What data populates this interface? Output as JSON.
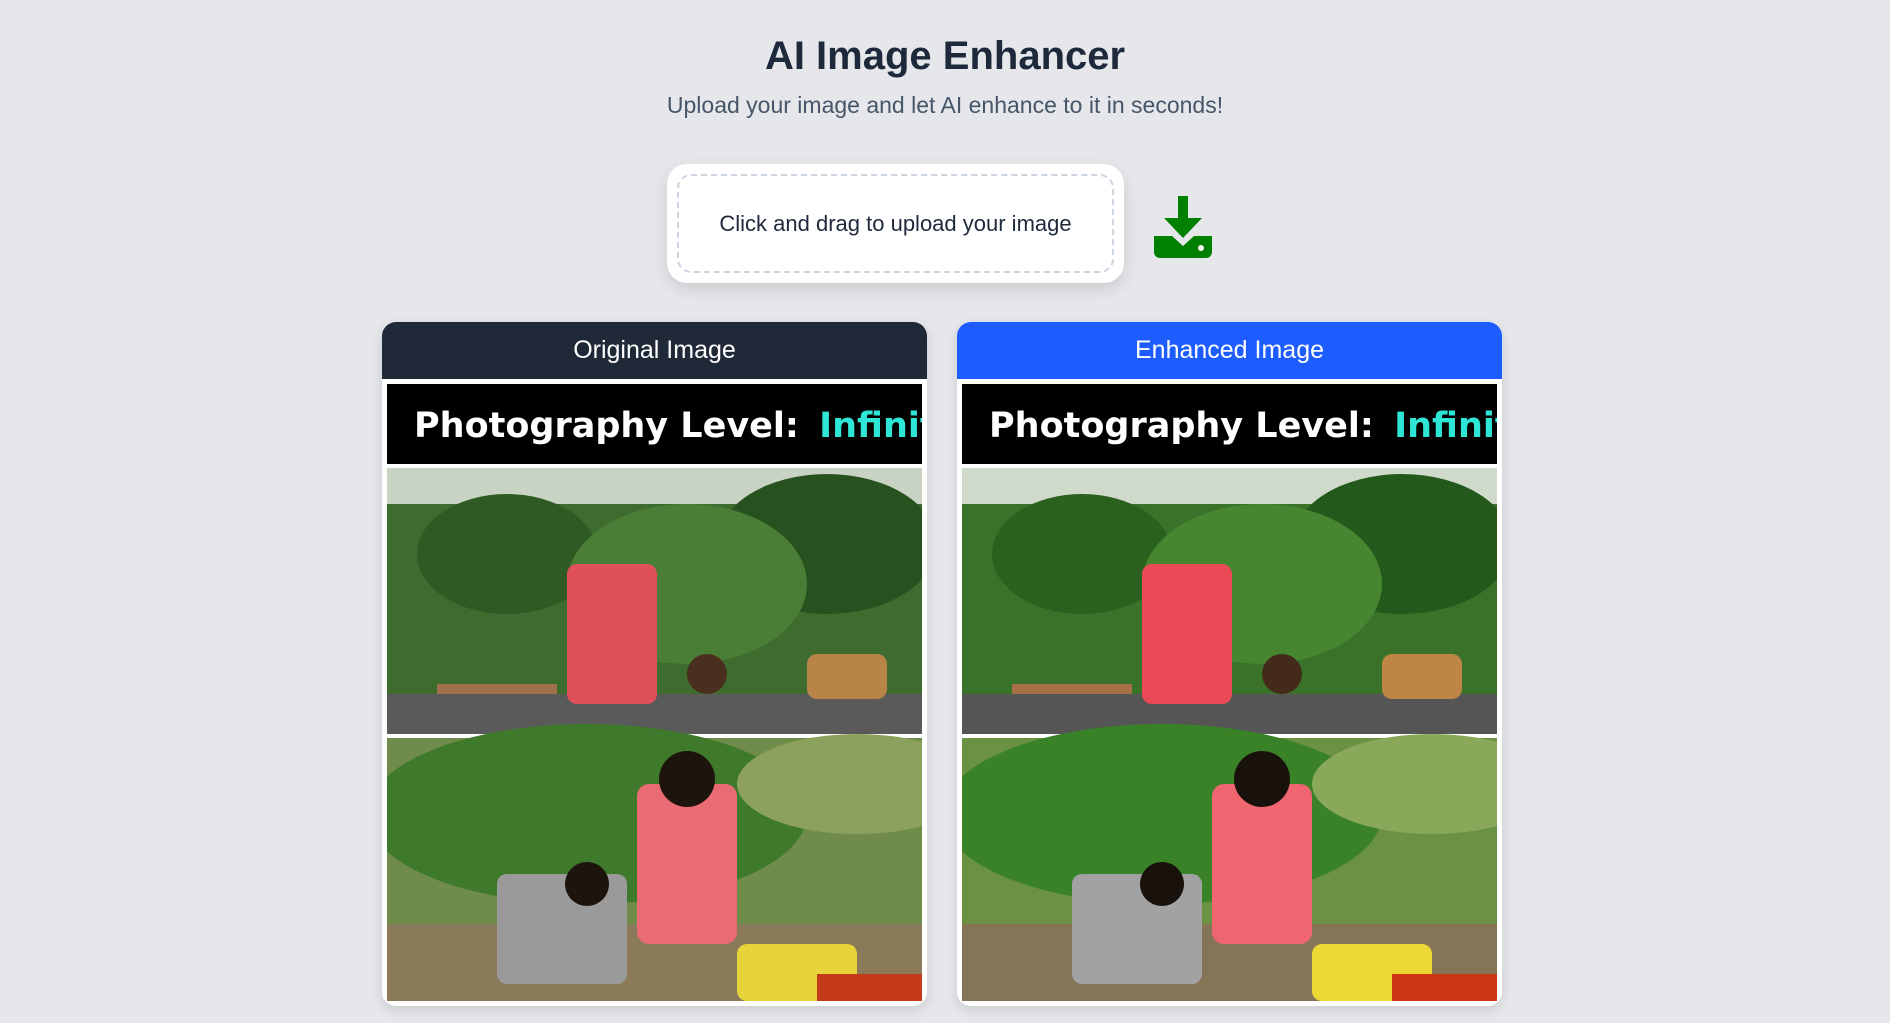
{
  "header": {
    "title": "AI Image Enhancer",
    "subtitle": "Upload your image and let AI enhance to it in seconds!"
  },
  "upload": {
    "label": "Click and drag to upload your image",
    "download_icon": "download-icon",
    "download_color": "#008000"
  },
  "panels": [
    {
      "label": "Original Image",
      "header_color": "#1f2937",
      "caption": {
        "text": "Photography Level:",
        "highlight": "Infinity"
      }
    },
    {
      "label": "Enhanced Image",
      "header_color": "#1d5cff",
      "caption": {
        "text": "Photography Level:",
        "highlight": "Infinity"
      }
    }
  ],
  "colors": {
    "page_bg": "#e5e7eb",
    "highlight_text": "#2ee6d6"
  }
}
